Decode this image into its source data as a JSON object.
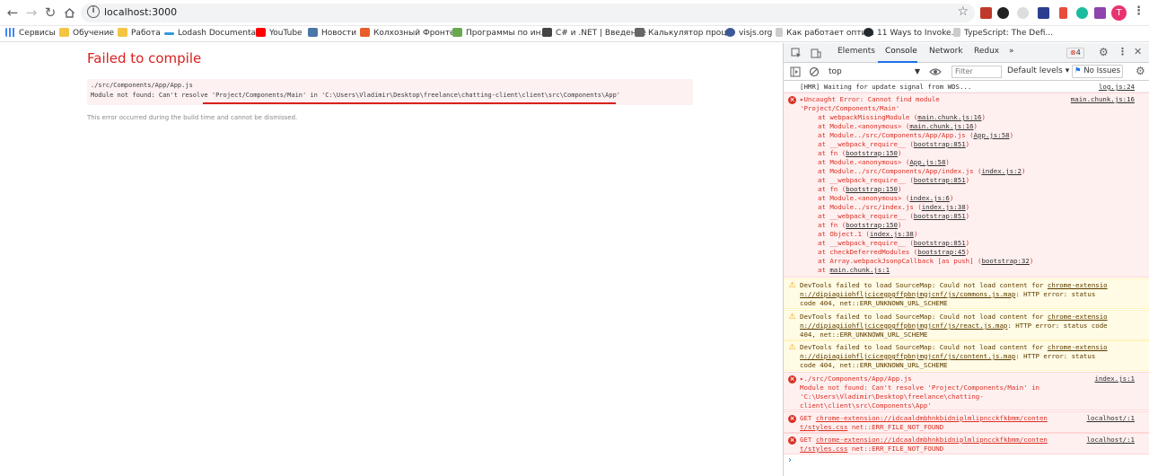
{
  "browser": {
    "url": "localhost:3000",
    "back_icon": "arrow-left-icon",
    "forward_icon": "arrow-right-icon",
    "reload_icon": "reload-icon",
    "home_icon": "home-icon",
    "avatar_letter": "T",
    "accent": "#e8336f"
  },
  "bookmarks": [
    {
      "label": "Сервисы",
      "color": "#4285f4"
    },
    {
      "label": "Обучение",
      "color": "#f4c542"
    },
    {
      "label": "Работа",
      "color": "#f4c542"
    },
    {
      "label": "Lodash Documenta...",
      "color": "#3498db"
    },
    {
      "label": "YouTube",
      "color": "#ff0000"
    },
    {
      "label": "Новости",
      "color": "#4a76a8"
    },
    {
      "label": "Колхозный Фронте...",
      "color": "#e85d2a"
    },
    {
      "label": "Программы по ин...",
      "color": "#6aa84f"
    },
    {
      "label": "C# и .NET | Введение",
      "color": "#444444"
    },
    {
      "label": "Калькулятор проц...",
      "color": "#666666"
    },
    {
      "label": "visjs.org",
      "color": "#3b5998"
    },
    {
      "label": "Как работает опти...",
      "color": "#999999"
    },
    {
      "label": "11 Ways to Invoke...",
      "color": "#24292e"
    },
    {
      "label": "TypeScript: The Defi...",
      "color": "#1a73e8"
    }
  ],
  "page": {
    "title": "Failed to compile",
    "file": "./src/Components/App/App.js",
    "message": "Module not found: Can't resolve 'Project/Components/Main' in 'C:\\Users\\Vladimir\\Desktop\\freelance\\chatting-client\\client\\src\\Components\\App'",
    "note": "This error occurred during the build time and cannot be dismissed.",
    "error_color": "#d9201d"
  },
  "devtools": {
    "tabs": [
      "Elements",
      "Console",
      "Network",
      "Redux"
    ],
    "active_tab": "Console",
    "more_tabs": "»",
    "error_count": "4",
    "context": "top",
    "filter_placeholder": "Filter",
    "levels": "Default levels ▾",
    "no_issues": "No Issues",
    "messages": {
      "hmr": {
        "text": "[HMR] Waiting for update signal from WDS...",
        "source": "log.js:24"
      },
      "uncaught": {
        "line1": "▸Uncaught Error: Cannot find module",
        "line2": "'Project/Components/Main'",
        "source": "main.chunk.js:16",
        "stack": [
          [
            "at webpackMissingModule (",
            "main.chunk.js:16",
            ")"
          ],
          [
            "at Module.<anonymous> (",
            "main.chunk.js:16",
            ")"
          ],
          [
            "at Module../src/Components/App/App.js (",
            "App.js:58",
            ")"
          ],
          [
            "at __webpack_require__ (",
            "bootstrap:851",
            ")"
          ],
          [
            "at fn (",
            "bootstrap:150",
            ")"
          ],
          [
            "at Module.<anonymous> (",
            "App.js:58",
            ")"
          ],
          [
            "at Module../src/Components/App/index.js (",
            "index.js:2",
            ")"
          ],
          [
            "at __webpack_require__ (",
            "bootstrap:851",
            ")"
          ],
          [
            "at fn (",
            "bootstrap:150",
            ")"
          ],
          [
            "at Module.<anonymous> (",
            "index.js:6",
            ")"
          ],
          [
            "at Module../src/index.js (",
            "index.js:38",
            ")"
          ],
          [
            "at __webpack_require__ (",
            "bootstrap:851",
            ")"
          ],
          [
            "at fn (",
            "bootstrap:150",
            ")"
          ],
          [
            "at Object.1 (",
            "index.js:38",
            ")"
          ],
          [
            "at __webpack_require__ (",
            "bootstrap:851",
            ")"
          ],
          [
            "at checkDeferredModules (",
            "bootstrap:45",
            ")"
          ],
          [
            "at Array.webpackJsonpCallback [as push] (",
            "bootstrap:32",
            ")"
          ],
          [
            "at ",
            "main.chunk.js:1",
            ""
          ]
        ]
      },
      "warn1": {
        "pre": "DevTools failed to load SourceMap: Could not load content for ",
        "link_a": "chrome-extensio",
        "link_b": "n://dipiagiiohfljcicegpgffpbnjmgjcnf/js/commons.js.map",
        "post_a": ": HTTP error: status",
        "post_b": "code 404, net::ERR_UNKNOWN_URL_SCHEME"
      },
      "warn2": {
        "pre": "DevTools failed to load SourceMap: Could not load content for ",
        "link_a": "chrome-extensio",
        "link_b": "n://dipiagiiohfljcicegpgffpbnjmgjcnf/js/react.js.map",
        "post_a": ": HTTP error: status code",
        "post_b": "404, net::ERR_UNKNOWN_URL_SCHEME"
      },
      "warn3": {
        "pre": "DevTools failed to load SourceMap: Could not load content for ",
        "link_a": "chrome-extensio",
        "link_b": "n://dipiagiiohfljcicegpgffpbnjmgjcnf/js/content.js.map",
        "post_a": ": HTTP error: status",
        "post_b": "code 404, net::ERR_UNKNOWN_URL_SCHEME"
      },
      "modnf": {
        "line1": "▸./src/Components/App/App.js",
        "line2": "Module not found: Can't resolve 'Project/Components/Main' in",
        "line3": "'C:\\Users\\Vladimir\\Desktop\\freelance\\chatting-",
        "line4": "client\\client\\src\\Components\\App'",
        "source": "index.js:1"
      },
      "get1": {
        "pre": "GET ",
        "link_a": "chrome-extension://idcaaldmbhnkbidniplmlipncckfkbmm/conten",
        "link_b": "t/styles.css",
        "post": " net::ERR_FILE_NOT_FOUND",
        "source": "localhost/:1"
      },
      "get2": {
        "pre": "GET ",
        "link_a": "chrome-extension://idcaaldmbhnkbidniplmlipncckfkbmm/conten",
        "link_b": "t/styles.css",
        "post": " net::ERR_FILE_NOT_FOUND",
        "source": "localhost/:1"
      }
    }
  }
}
